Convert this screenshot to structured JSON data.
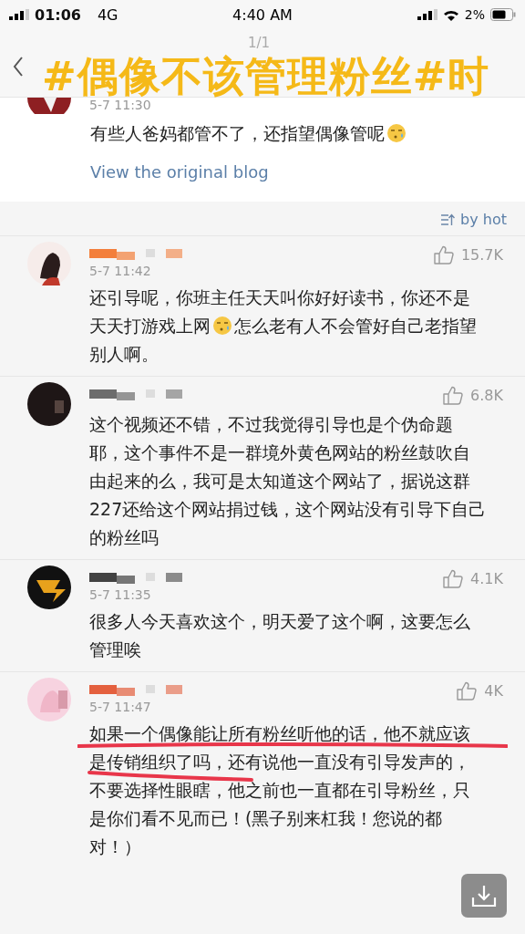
{
  "status_bar": {
    "clock_overlay": "01:06",
    "network": "4G",
    "time": "4:40 AM",
    "battery": "2%"
  },
  "nav": {
    "page_counter": "1/1"
  },
  "caption_overlay": "#偶像不该管理粉丝#时",
  "original_post": {
    "time": "5-7 11:30",
    "body": [
      {
        "kind": "text",
        "text": "有些人爸妈都管不了，还指望偶像管呢"
      },
      {
        "kind": "emoji"
      }
    ],
    "link": "View the original blog"
  },
  "sort": {
    "label": "by hot"
  },
  "comments": [
    {
      "time": "5-7 11:42",
      "likes": "15.7K",
      "body": [
        {
          "kind": "text",
          "text": "还引导呢，你班主任天天叫你好好读书，你还不是天天打游戏上网"
        },
        {
          "kind": "emoji"
        },
        {
          "kind": "text",
          "text": "怎么老有人不会管好自己老指望别人啊。"
        }
      ]
    },
    {
      "likes": "6.8K",
      "body": [
        {
          "kind": "text",
          "text": "这个视频还不错，不过我觉得引导也是个伪命题耶，这个事件不是一群境外黄色网站的粉丝鼓吹自由起来的么，我可是太知道这个网站了，据说这群227还给这个网站捐过钱，这个网站没有引导下自己的粉丝吗"
        }
      ]
    },
    {
      "time": "5-7 11:35",
      "likes": "4.1K",
      "body": [
        {
          "kind": "text",
          "text": "很多人今天喜欢这个，明天爱了这个啊，这要怎么管理唉"
        }
      ]
    },
    {
      "time": "5-7 11:47",
      "likes": "4K",
      "underlined": true,
      "body": [
        {
          "kind": "text",
          "text": "如果一个偶像能让所有粉丝听他的话，他不就应该是传销组织了吗，还有说他一直没有引导发声的，不要选择性眼瞎，他之前也一直都在引导粉丝，只是你们看不见而已！(黑子别来杠我！您说的都对！）"
        }
      ]
    }
  ]
}
